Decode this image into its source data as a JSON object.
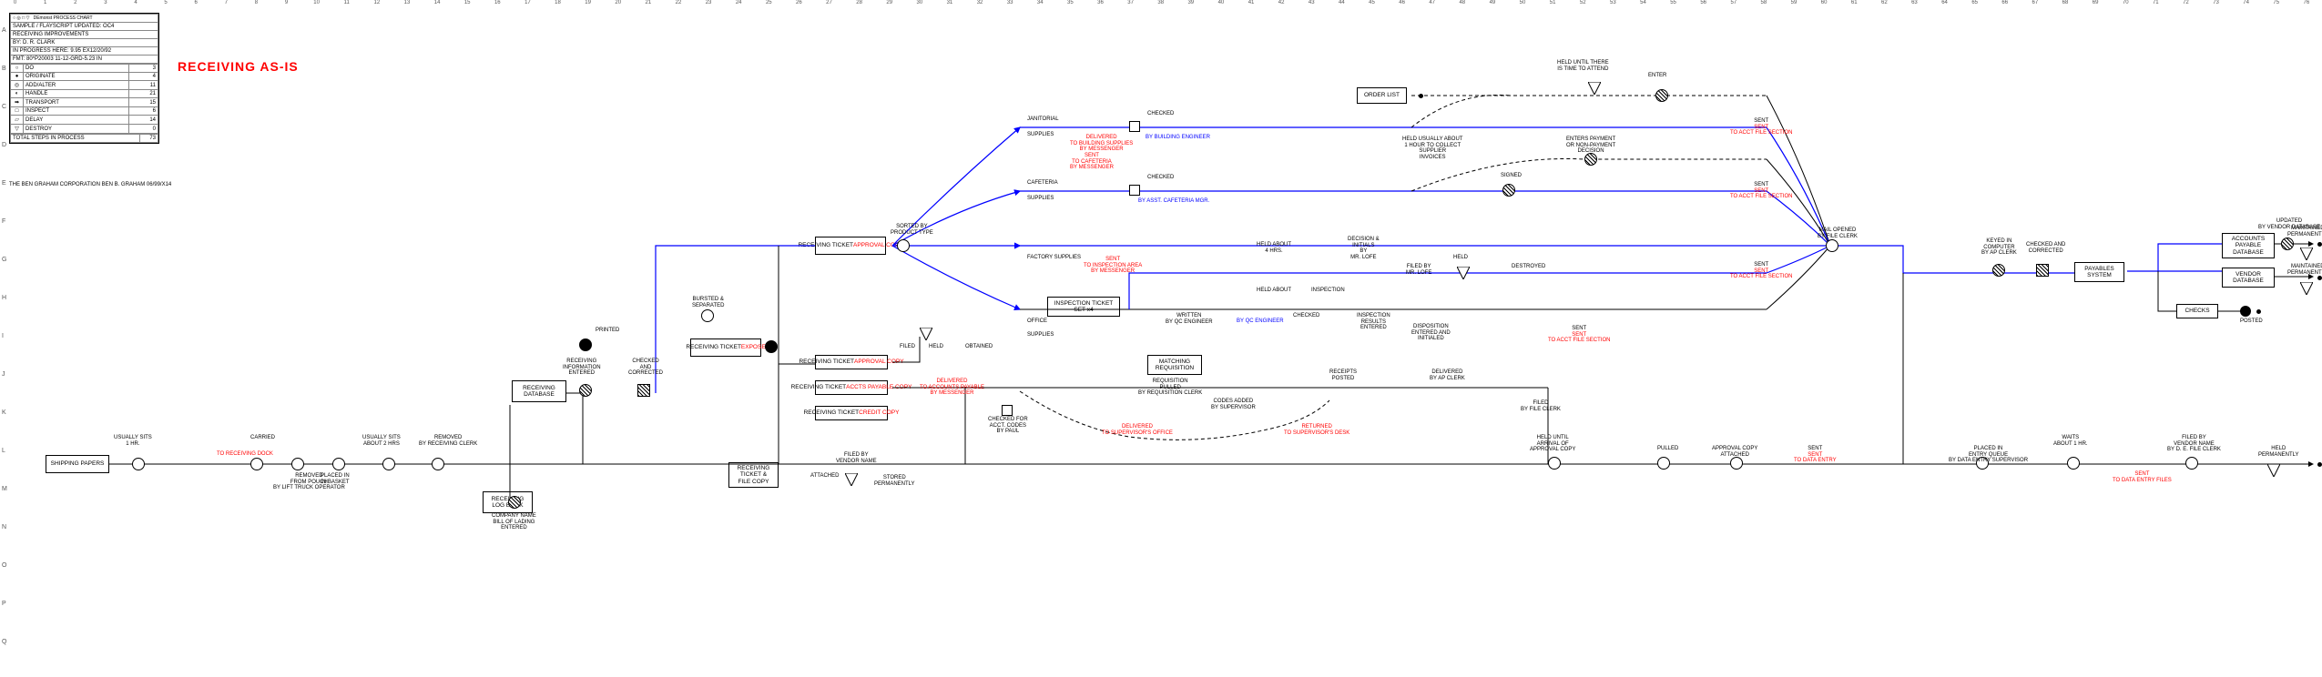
{
  "ruler": [
    "0",
    "1",
    "2",
    "3",
    "4",
    "5",
    "6",
    "7",
    "8",
    "9",
    "10",
    "11",
    "12",
    "13",
    "14",
    "15",
    "16",
    "17",
    "18",
    "19",
    "20",
    "21",
    "22",
    "23",
    "24",
    "25",
    "26",
    "27",
    "28",
    "29",
    "30",
    "31",
    "32",
    "33",
    "34",
    "35",
    "36",
    "37",
    "38",
    "39",
    "40",
    "41",
    "42",
    "43",
    "44",
    "45",
    "46",
    "47",
    "48",
    "49",
    "50",
    "51",
    "52",
    "53",
    "54",
    "55",
    "56",
    "57",
    "58",
    "59",
    "60",
    "61",
    "62",
    "63",
    "64",
    "65",
    "66",
    "67",
    "68",
    "69",
    "70",
    "71",
    "72",
    "73",
    "74",
    "75",
    "76"
  ],
  "rowLabels": [
    "A",
    "B",
    "C",
    "D",
    "E",
    "F",
    "G",
    "H",
    "I",
    "J",
    "K",
    "L",
    "M",
    "N",
    "O",
    "P",
    "Q"
  ],
  "title": "RECEIVING AS-IS",
  "legend": {
    "hdr": [
      "",
      "DEmonst PROCESS CHART"
    ],
    "rows": [
      [
        "SAMPLE / FLAYSCRIPT UPDATED: OC4",
        ""
      ],
      [
        "RECEIVING IMPROVEMENTS",
        ""
      ],
      [
        "BY: D. R. CLARK",
        ""
      ],
      [
        "IN PROGRESS HERE: 9.95 EX12/20/92",
        ""
      ],
      [
        "FMT: 80*P20003 11-12-GRD-5.23 IN",
        ""
      ]
    ],
    "steps": [
      [
        "○",
        "DO",
        "3"
      ],
      [
        "●",
        "ORIGINATE",
        "4"
      ],
      [
        "◎",
        "ADD/ALTER",
        "11"
      ],
      [
        "◐",
        "HANDLE",
        "21"
      ],
      [
        "➡",
        "TRANSPORT",
        "15"
      ],
      [
        "□",
        "INSPECT",
        "6"
      ],
      [
        "▱",
        "DELAY",
        "14"
      ],
      [
        "▽",
        "DESTROY",
        "0"
      ]
    ],
    "total": [
      "TOTAL STEPS IN PROCESS",
      "73"
    ]
  },
  "corp": "THE BEN GRAHAM CORPORATION\nBEN B. GRAHAM\n06/99/X14",
  "boxes": {
    "shipping": "SHIPPING PAPERS",
    "recvDb": "RECEIVING\nDATABASE",
    "recvLog": "RECEIVING\nLOG BOOK",
    "rtExpose": "RECEIVING TICKET",
    "rtExposeSub": "EXPOSE",
    "rtApproval": "RECEIVING TICKET",
    "rtApprovalSub": "APPROVAL COPY",
    "rtFile": "RECEIVING\nTICKET &\nFILE COPY",
    "order": "ORDER LIST",
    "rtAppr2": "RECEIVING TICKET\n",
    "rtAppr2Sub": "APPROVAL COPY",
    "rtAP": "RECEIVING TICKET\n",
    "rtAPSub": "ACCTS PAYABLE COPY",
    "rtCredit": "RECEIVING TICKET\n",
    "rtCreditSub": "CREDIT COPY",
    "matchReq": "MATCHING\nREQUISITION",
    "inspTicket": "INSPECTION TICKET\nSET x4",
    "payables": "PAYABLES\nSYSTEM",
    "apDb": "ACCOUNTS\nPAYABLE\nDATABASE",
    "vendorDb": "VENDOR\nDATABASE",
    "checks": "CHECKS"
  },
  "labels": {
    "usuallySits": "USUALLY SITS\n1 HR.",
    "toRecvDock": "TO RECEIVING DOCK",
    "carried": "CARRIED",
    "removed": "REMOVED\nFROM POUCH\nBY LIFT TRUCK OPERATOR",
    "placedIn": "PLACED IN\nIN BASKET",
    "usuallySits2": "USUALLY SITS\nABOUT 2 HRS",
    "removedBy": "REMOVED\nBY RECEIVING CLERK",
    "recvInfo": "RECEIVING\nINFORMATION\nENTERED",
    "printed": "PRINTED",
    "checkedCorr": "CHECKED\nAND\nCORRECTED",
    "burstSep": "BURSTED &\nSEPARATED",
    "compNameBol": "COMPANY NAME\nBILL OF LADING\nENTERED",
    "sortedProd": "SORTED BY\nPRODUCT TYPE",
    "janitorial": "JANITORIAL",
    "supplies": "SUPPLIES",
    "cafeteria": "CAFETERIA",
    "factory": "FACTORY SUPPLIES",
    "office": "OFFICE",
    "delivBldg": "DELIVERED\nTO BUILDING SUPPLIES\nBY MESSENGER",
    "sentCaf": "SENT\nTO CAFETERIA\nBY MESSENGER",
    "checked": "CHECKED",
    "byBldgEng": "BY BUILDING ENGINEER",
    "byCafMgr": "BY ASST. CAFETERIA MGR.",
    "sentInsp": "SENT\nTO INSPECTION AREA\nBY MESSENGER",
    "heldAbout4": "HELD ABOUT\n4 HRS.",
    "heldAbout": "HELD ABOUT",
    "written": "WRITTEN\nBY QC ENGINEER",
    "byQc": "BY QC ENGINEER",
    "inspection": "INSPECTION",
    "checked2": "CHECKED",
    "decision": "DECISION &\nINITIALS\nBY\nMR. LOFE",
    "filedBy": "FILED BY\nMR. LOFE",
    "heldVari": "HELD",
    "destroyed": "DESTROYED",
    "dispEntered": "DISPOSITION\nENTERED AND\nINITIALED",
    "inspResults": "INSPECTION\nRESULTS\nENTERED",
    "sentToAcct": "SENT\nTO ACCT FILE SECTION",
    "heldUntilTime": "HELD UNTIL THERE\nIS TIME TO ATTEND",
    "enter": "ENTER",
    "heldUsually1hr": "HELD USUALLY ABOUT\n1 HOUR TO COLLECT\nSUPPLIER\nINVOICES",
    "signed": "SIGNED",
    "entersPayment": "ENTERS PAYMENT\nOR NON-PAYMENT\nDECISION",
    "filed": "FILED",
    "held": "HELD",
    "obtained": "OBTAINED",
    "delivAP": "DELIVERED\nTO ACCOUNTS PAYABLE\nBY MESSENGER",
    "checkedAcct": "CHECKED FOR\nACCT. CODES\nBY PAUL",
    "attached": "ATTACHED",
    "filedVendor": "FILED BY\nVENDOR NAME",
    "storedPerm": "STORED\nPERMANENTLY",
    "delivSup": "DELIVERED\nTO SUPERVISOR'S OFFICE",
    "codesAdded": "CODES ADDED\nBY SUPERVISOR",
    "returned": "RETURNED\nTO SUPERVISOR'S DESK",
    "reqPulled": "REQUISITION\nPULLED\nBY REQUISITION CLERK",
    "receiptsPosted": "RECEIPTS\nPOSTED",
    "delivAPCopy": "DELIVERED\nBY AP CLERK",
    "filedFileClerk": "FILED\nBY FILE CLERK",
    "heldUntilArrival": "HELD UNTIL\nARRIVAL OF\nAPPROVAL COPY",
    "pulled": "PULLED",
    "apprCopyAtt": "APPROVAL COPY\nATTACHED",
    "sentDataEntry": "SENT\nTO DATA ENTRY",
    "placedEntryQ": "PLACED IN\nENTRY QUEUE\nBY DATA ENTRY SUPERVISOR",
    "waitsAbout": "WAITS\nABOUT 1 HR.",
    "filedVendor2": "FILED BY\nVENDOR NAME\nBY D. E. FILE CLERK",
    "sentDEfiles": "SENT\nTO DATA ENTRY FILES",
    "heldPerm": "HELD\nPERMANENTLY",
    "mailOpened": "MAIL OPENED\nBY FILE CLERK",
    "keyedComp": "KEYED IN\nCOMPUTER\nBY AP CLERK",
    "checkedCorr2": "CHECKED AND\nCORRECTED",
    "updatedVendor": "UPDATED\nBY VENDOR DATABASE",
    "maintPerm": "MAINTAINED\nPERMANENTLY",
    "posted": "POSTED"
  }
}
